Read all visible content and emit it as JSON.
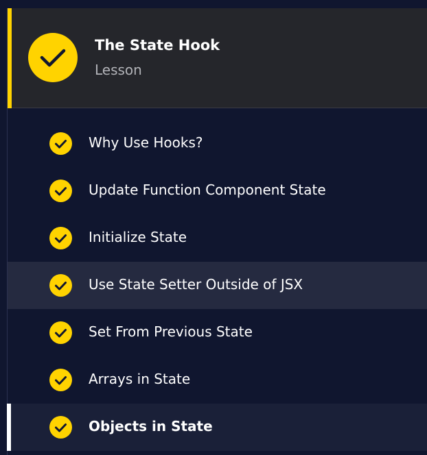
{
  "lesson": {
    "title": "The State Hook",
    "type": "Lesson",
    "status_icon": "checkmark-icon"
  },
  "exercises": [
    {
      "label": "Why Use Hooks?",
      "completed": true,
      "state": "default"
    },
    {
      "label": "Update Function Component State",
      "completed": true,
      "state": "default"
    },
    {
      "label": "Initialize State",
      "completed": true,
      "state": "default"
    },
    {
      "label": "Use State Setter Outside of JSX",
      "completed": true,
      "state": "hover"
    },
    {
      "label": "Set From Previous State",
      "completed": true,
      "state": "default"
    },
    {
      "label": "Arrays in State",
      "completed": true,
      "state": "default"
    },
    {
      "label": "Objects in State",
      "completed": true,
      "state": "current"
    }
  ],
  "colors": {
    "background": "#10162f",
    "header_bg": "#25262b",
    "accent_yellow": "#ffd300",
    "hover_row": "#252a40",
    "current_row": "#1a2038",
    "current_indicator": "#ffffff",
    "text_primary": "#ffffff",
    "text_secondary": "#b2b3b8"
  }
}
